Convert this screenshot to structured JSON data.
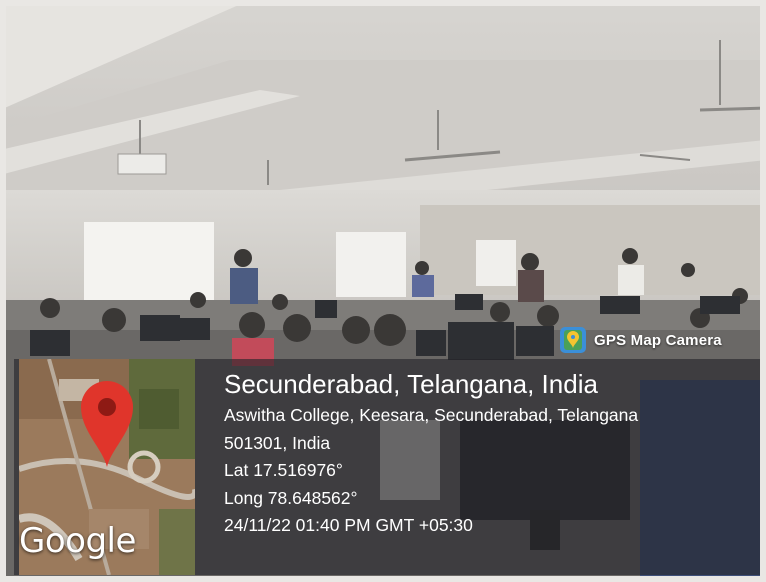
{
  "badge": {
    "label": "GPS Map Camera",
    "icon": "map-pin-icon",
    "color": "#3b8fd8"
  },
  "map": {
    "provider_label": "Google",
    "marker_color": "#e0352b"
  },
  "location": {
    "title": "Secunderabad, Telangana, India",
    "address_line1": "Aswitha College, Keesara, Secunderabad, Telangana",
    "address_line2": "501301, India",
    "latitude": "Lat 17.516976°",
    "longitude": "Long 78.648562°",
    "timestamp": "24/11/22 01:40 PM GMT +05:30"
  }
}
